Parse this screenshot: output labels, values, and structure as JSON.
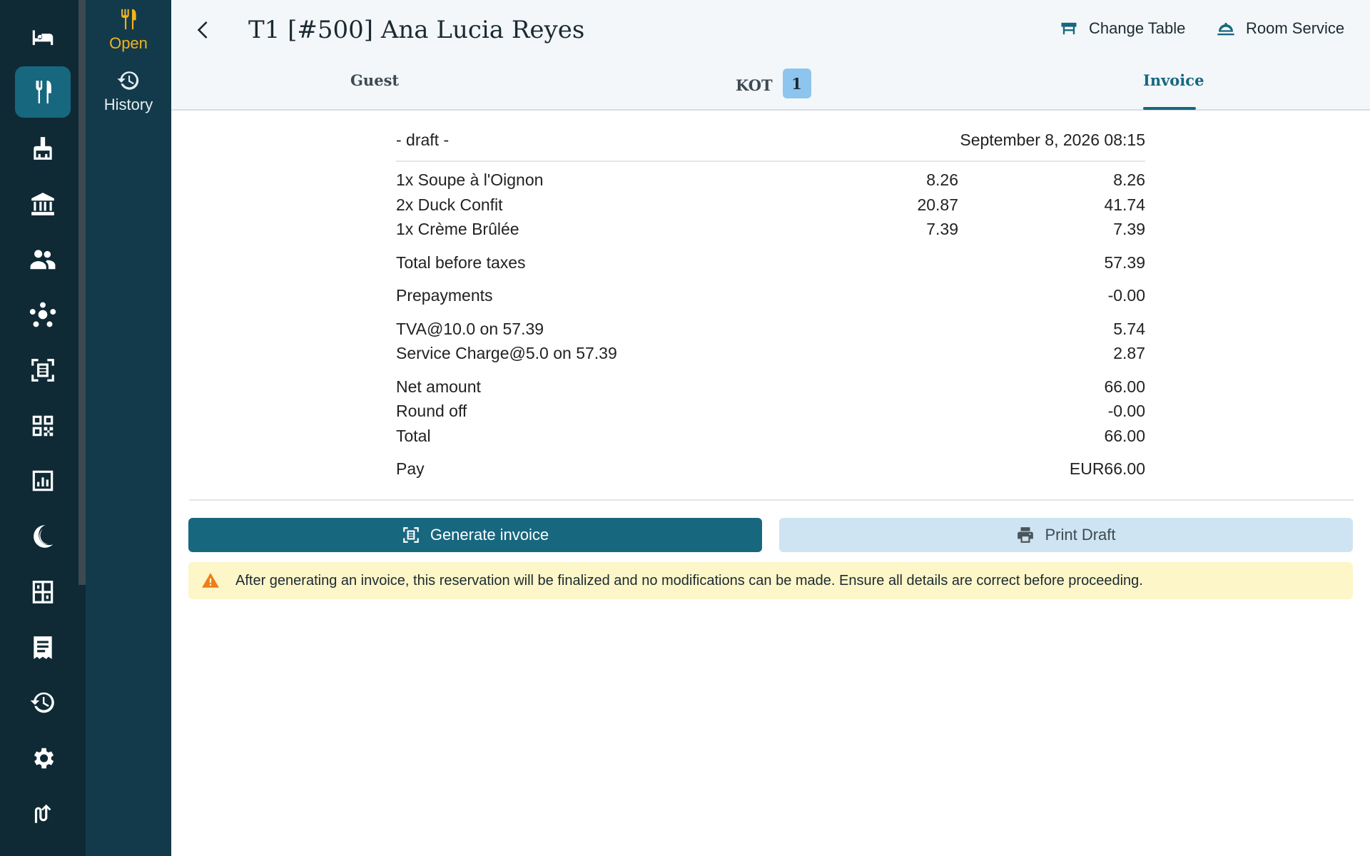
{
  "rail": {
    "items": [
      {
        "icon": "bed-icon"
      },
      {
        "icon": "restaurant-icon",
        "active": true
      },
      {
        "icon": "housekeeping-icon"
      },
      {
        "icon": "bank-icon"
      },
      {
        "icon": "people-icon"
      },
      {
        "icon": "network-icon"
      },
      {
        "icon": "invoice-icon"
      },
      {
        "icon": "qr-code-icon"
      },
      {
        "icon": "report-icon"
      },
      {
        "icon": "night-audit-icon"
      },
      {
        "icon": "floor-plan-icon"
      },
      {
        "icon": "receipt-icon"
      },
      {
        "icon": "history-icon"
      },
      {
        "icon": "gear-icon"
      },
      {
        "icon": "switch-icon"
      }
    ]
  },
  "subnav": {
    "open_label": "Open",
    "history_label": "History"
  },
  "header": {
    "title": "T1 [#500] Ana Lucia Reyes",
    "change_table_label": "Change Table",
    "room_service_label": "Room Service"
  },
  "tabs": {
    "guest": "Guest",
    "kot": "KOT",
    "kot_count": "1",
    "invoice": "Invoice",
    "active": "invoice"
  },
  "invoice": {
    "status": "- draft -",
    "date": "September 8, 2026 08:15",
    "items": [
      {
        "desc": "1x Soupe à l'Oignon",
        "unit": "8.26",
        "amount": "8.26"
      },
      {
        "desc": "2x Duck Confit",
        "unit": "20.87",
        "amount": "41.74"
      },
      {
        "desc": "1x Crème Brûlée",
        "unit": "7.39",
        "amount": "7.39"
      }
    ],
    "total_before_taxes_label": "Total before taxes",
    "total_before_taxes": "57.39",
    "prepayments_label": "Prepayments",
    "prepayments": "-0.00",
    "taxes": [
      {
        "label": "TVA@10.0 on 57.39",
        "amount": "5.74"
      },
      {
        "label": "Service Charge@5.0 on 57.39",
        "amount": "2.87"
      }
    ],
    "net_amount_label": "Net amount",
    "net_amount": "66.00",
    "round_off_label": "Round off",
    "round_off": "-0.00",
    "total_label": "Total",
    "total": "66.00",
    "pay_label": "Pay",
    "pay": "EUR66.00"
  },
  "actions": {
    "generate_label": "Generate invoice",
    "print_label": "Print Draft"
  },
  "warning": {
    "text": "After generating an invoice, this reservation will be finalized and no modifications can be made. Ensure all details are correct before proceeding."
  },
  "colors": {
    "rail_bg": "#0f2a35",
    "subnav_bg": "#123a4a",
    "accent": "#17677f",
    "open_accent": "#f5b31b",
    "badge": "#8ec5ee",
    "warning_bg": "#fcf6c8"
  }
}
